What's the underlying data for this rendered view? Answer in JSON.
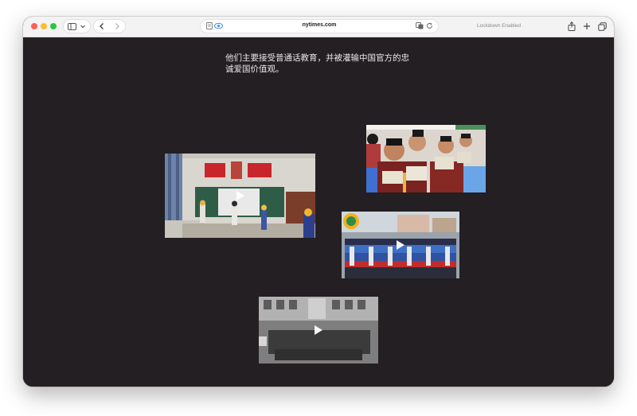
{
  "browser": {
    "url": "nytimes.com",
    "lockdown_label": "Lockdown Enabled",
    "colors": {
      "close": "#fe5f57",
      "minimize": "#febc2e",
      "maximize": "#28c840",
      "page_background": "#231f22"
    }
  },
  "article": {
    "caption": "他们主要接受普通话教育，并被灌输中国官方的忠诚爱国价值观。"
  },
  "media": [
    {
      "name": "classroom-video",
      "is_video": true
    },
    {
      "name": "students-reading-photo",
      "is_video": false
    },
    {
      "name": "students-assembly-video",
      "is_video": true
    },
    {
      "name": "students-marching-video",
      "is_video": true
    }
  ]
}
